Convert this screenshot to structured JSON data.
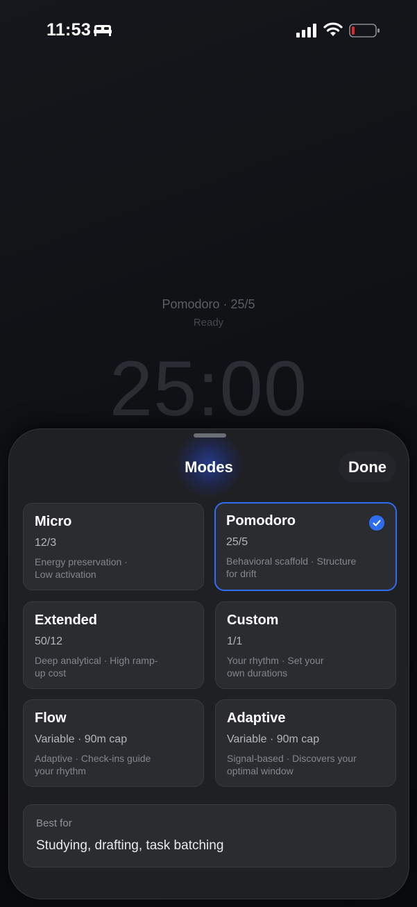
{
  "status_bar": {
    "time": "11:53",
    "icons": [
      "bed-icon",
      "signal-icon",
      "wifi-icon",
      "battery-low-icon"
    ],
    "battery_color": "#e0292b"
  },
  "background": {
    "mode_line": "Pomodoro · 25/5",
    "state": "Ready",
    "timer": "25:00"
  },
  "sheet": {
    "title": "Modes",
    "done_label": "Done",
    "accent_color": "#2f6df0",
    "modes": [
      {
        "title": "Micro",
        "ratio": "12/3",
        "desc1": "Energy preservation ·",
        "desc2": "Low activation",
        "selected": false
      },
      {
        "title": "Pomodoro",
        "ratio": "25/5",
        "desc1": "Behavioral scaffold · Structure",
        "desc2": "for drift",
        "selected": true
      },
      {
        "title": "Extended",
        "ratio": "50/12",
        "desc1": "Deep analytical · High ramp-",
        "desc2": "up cost",
        "selected": false
      },
      {
        "title": "Custom",
        "ratio": "1/1",
        "desc1": "Your rhythm · Set your",
        "desc2": "own durations",
        "selected": false
      },
      {
        "title": "Flow",
        "ratio": "Variable · 90m cap",
        "desc1": "Adaptive · Check-ins guide",
        "desc2": "your rhythm",
        "selected": false
      },
      {
        "title": "Adaptive",
        "ratio": "Variable · 90m cap",
        "desc1": "Signal-based · Discovers your",
        "desc2": "optimal window",
        "selected": false
      }
    ],
    "best_for": {
      "label": "Best for",
      "value": "Studying, drafting, task batching"
    }
  }
}
